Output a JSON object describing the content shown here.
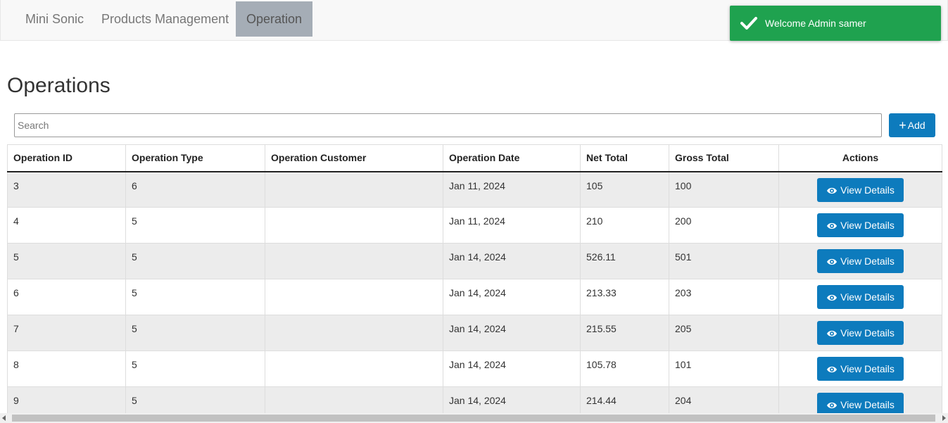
{
  "nav": {
    "brand": "Mini Sonic",
    "items": [
      "Products Management",
      "Operation"
    ],
    "active": "Operation"
  },
  "toast": {
    "message": "Welcome Admin samer",
    "icon": "check-icon",
    "color": "#1fa24f"
  },
  "page": {
    "title": "Operations"
  },
  "search": {
    "placeholder": "Search",
    "value": ""
  },
  "add_button": {
    "label": "Add",
    "icon": "plus-icon"
  },
  "table": {
    "columns": [
      "Operation ID",
      "Operation Type",
      "Operation Customer",
      "Operation Date",
      "Net Total",
      "Gross Total",
      "Actions"
    ],
    "rows": [
      {
        "id": "3",
        "type": "6",
        "customer": "",
        "date": "Jan 11, 2024",
        "net": "105",
        "gross": "100"
      },
      {
        "id": "4",
        "type": "5",
        "customer": "",
        "date": "Jan 11, 2024",
        "net": "210",
        "gross": "200"
      },
      {
        "id": "5",
        "type": "5",
        "customer": "",
        "date": "Jan 14, 2024",
        "net": "526.11",
        "gross": "501"
      },
      {
        "id": "6",
        "type": "5",
        "customer": "",
        "date": "Jan 14, 2024",
        "net": "213.33",
        "gross": "203"
      },
      {
        "id": "7",
        "type": "5",
        "customer": "",
        "date": "Jan 14, 2024",
        "net": "215.55",
        "gross": "205"
      },
      {
        "id": "8",
        "type": "5",
        "customer": "",
        "date": "Jan 14, 2024",
        "net": "105.78",
        "gross": "101"
      },
      {
        "id": "9",
        "type": "5",
        "customer": "",
        "date": "Jan 14, 2024",
        "net": "214.44",
        "gross": "204"
      }
    ],
    "action_label": "View Details",
    "action_icon": "eye-icon"
  },
  "colors": {
    "primary": "#0d7bbd",
    "success": "#1fa24f",
    "nav_active": "#a5adb6"
  }
}
